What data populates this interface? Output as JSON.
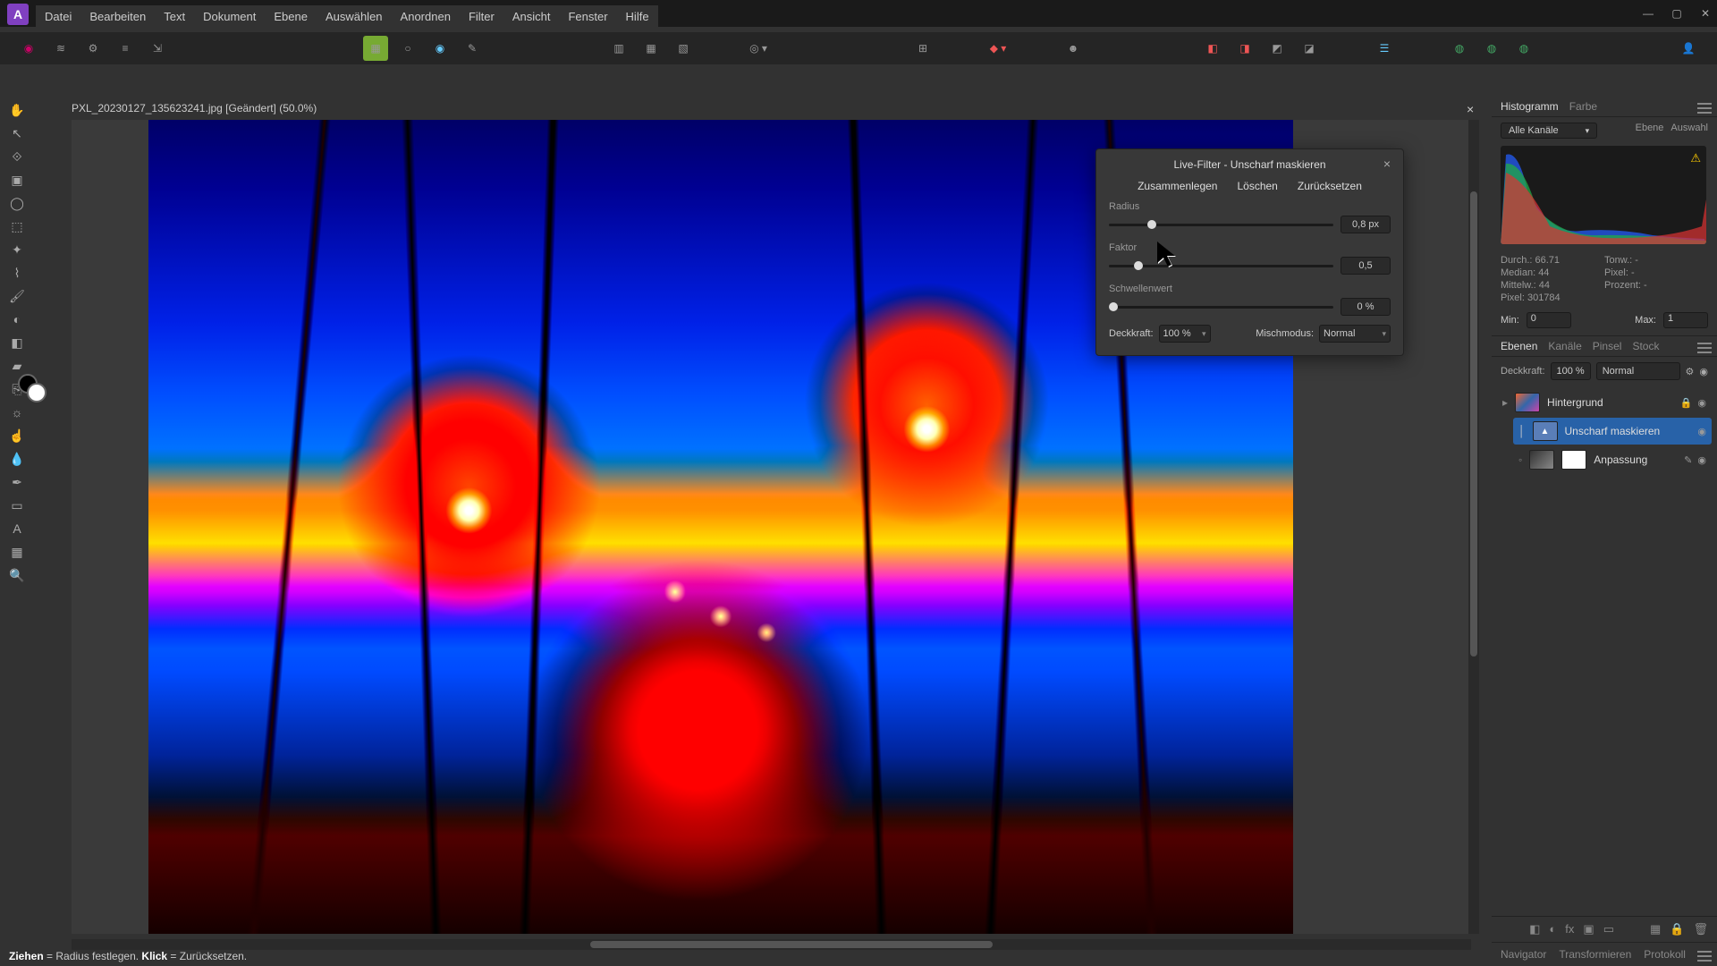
{
  "menubar": {
    "items": [
      "Datei",
      "Bearbeiten",
      "Text",
      "Dokument",
      "Ebene",
      "Auswählen",
      "Anordnen",
      "Filter",
      "Ansicht",
      "Fenster",
      "Hilfe"
    ]
  },
  "document": {
    "tab_label": "PXL_20230127_135623241.jpg [Geändert] (50.0%)"
  },
  "statusbar": {
    "drag_bold": "Ziehen",
    "drag_rest": " = Radius festlegen. ",
    "click_bold": "Klick",
    "click_rest": " = Zurücksetzen."
  },
  "filter_dialog": {
    "title": "Live-Filter - Unscharf maskieren",
    "actions": {
      "merge": "Zusammenlegen",
      "delete": "Löschen",
      "reset": "Zurücksetzen"
    },
    "params": [
      {
        "label": "Radius",
        "value": "0,8 px",
        "pct": 19
      },
      {
        "label": "Faktor",
        "value": "0,5",
        "pct": 13
      },
      {
        "label": "Schwellenwert",
        "value": "0 %",
        "pct": 2
      }
    ],
    "opacity_label": "Deckkraft:",
    "opacity_value": "100 %",
    "blend_label": "Mischmodus:",
    "blend_value": "Normal"
  },
  "right_panel": {
    "tabs1": {
      "histogram": "Histogramm",
      "color": "Farbe"
    },
    "histo": {
      "channel": "Alle Kanäle",
      "side": {
        "layer": "Ebene",
        "selection": "Auswahl"
      },
      "stats": {
        "durch": "Durch.: 66.71",
        "tonw": "Tonw.: -",
        "median": "Median: 44",
        "pixel_s": "Pixel: -",
        "mittelw": "Mittelw.: 44",
        "prozent": "Prozent: -",
        "pixel": "Pixel: 301784"
      },
      "min_label": "Min:",
      "min_value": "0",
      "max_label": "Max:",
      "max_value": "1"
    },
    "tabs2": {
      "layers": "Ebenen",
      "channels": "Kanäle",
      "brush": "Pinsel",
      "stock": "Stock"
    },
    "layers": {
      "opacity_label": "Deckkraft:",
      "opacity_value": "100 %",
      "blend_value": "Normal",
      "items": [
        {
          "name": "Hintergrund",
          "type": "image",
          "selected": false,
          "locked": true
        },
        {
          "name": "Unscharf maskieren",
          "type": "filter",
          "selected": true,
          "sub": true
        },
        {
          "name": "Anpassung",
          "type": "adjust",
          "selected": false,
          "sub": true
        }
      ]
    },
    "tabs3": {
      "navigator": "Navigator",
      "transform": "Transformieren",
      "history": "Protokoll"
    }
  },
  "icons": {
    "arrow": "↖",
    "hand": "✋",
    "crop": "▣",
    "node": "↘",
    "brush": "🖌",
    "pencil": "✎",
    "eraser": "⌫",
    "fill": "▮",
    "clone": "⎘",
    "heal": "✚",
    "blur": "◐",
    "dodge": "☀",
    "text": "A",
    "grid": "▦",
    "picker": "◉"
  }
}
